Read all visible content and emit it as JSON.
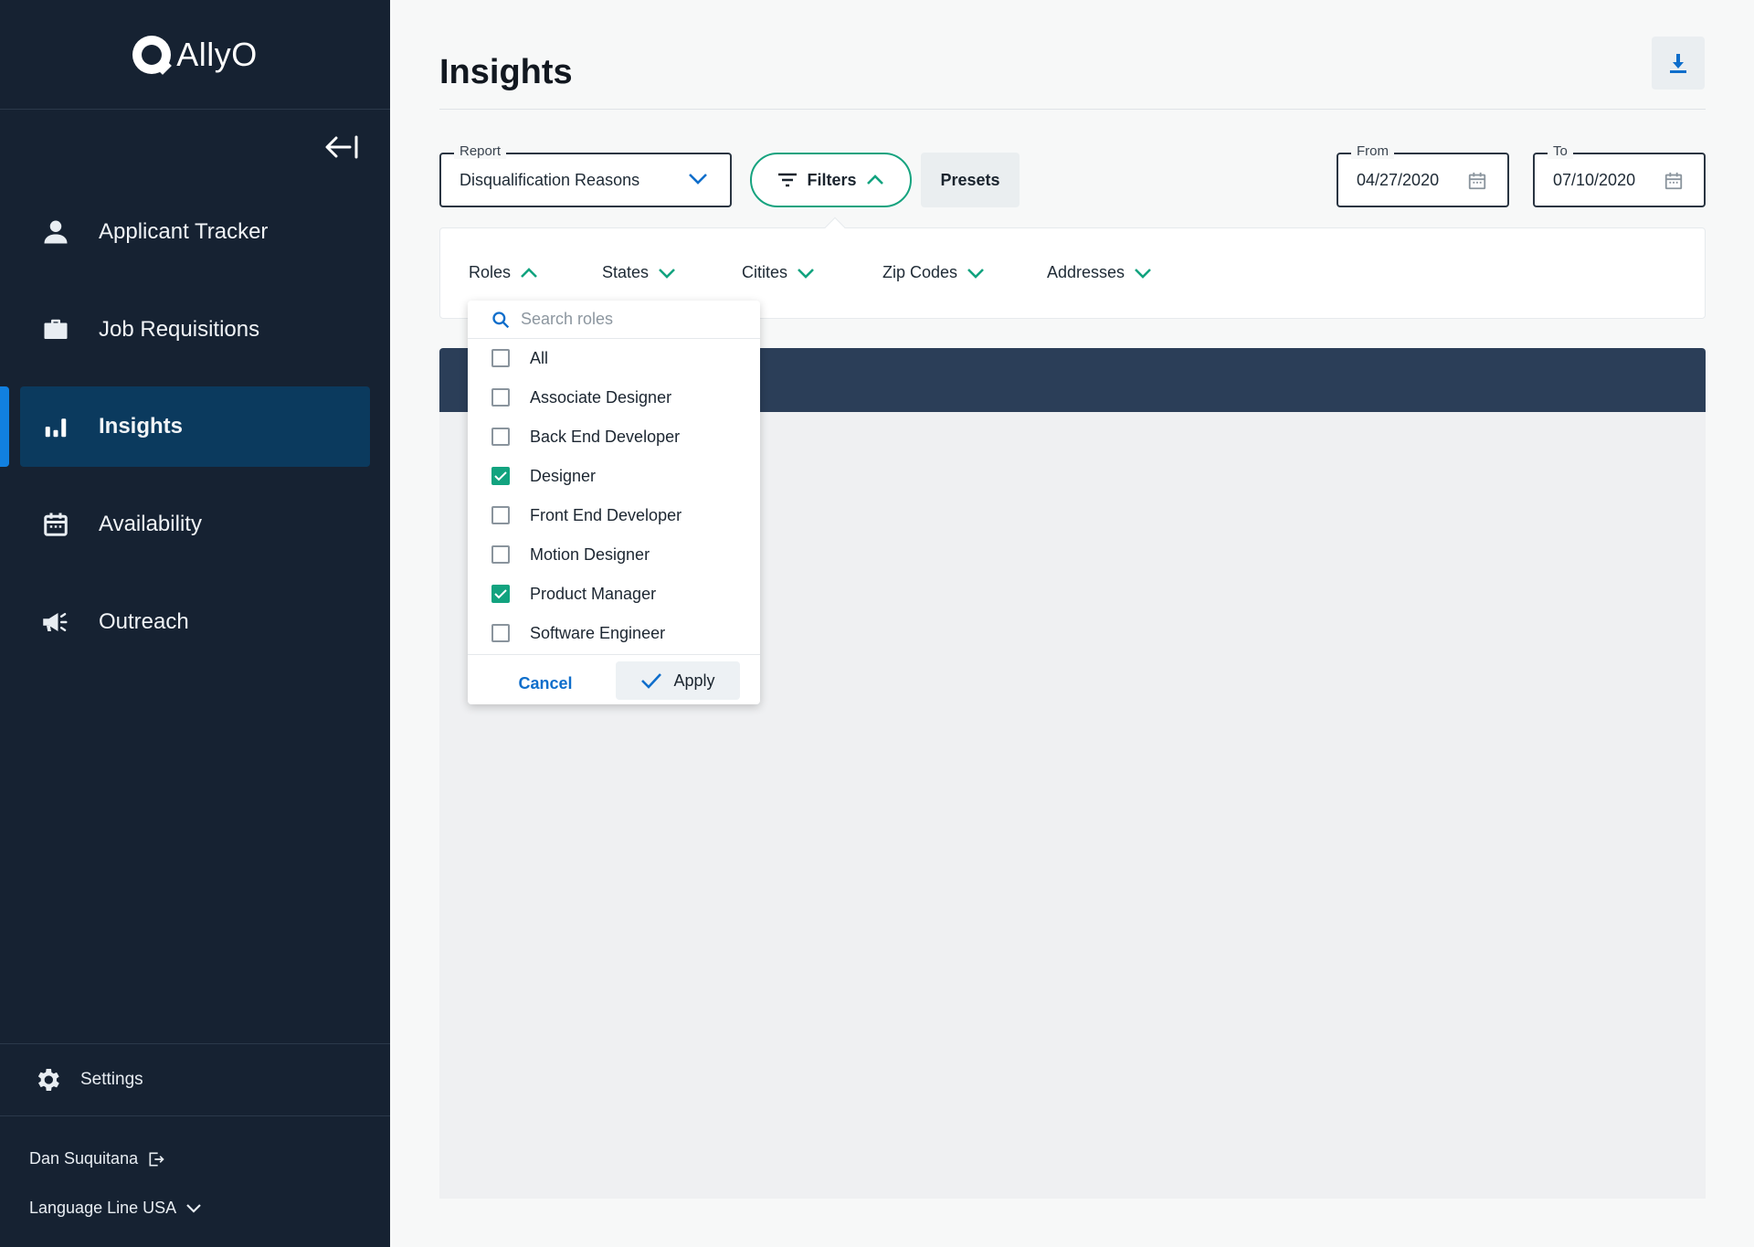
{
  "sidebar": {
    "brand": "AllyO",
    "nav": [
      {
        "label": "Applicant Tracker",
        "icon": "person-icon"
      },
      {
        "label": "Job Requisitions",
        "icon": "briefcase-icon"
      },
      {
        "label": "Insights",
        "icon": "bar-chart-icon",
        "active": true
      },
      {
        "label": "Availability",
        "icon": "calendar-icon"
      },
      {
        "label": "Outreach",
        "icon": "megaphone-icon"
      }
    ],
    "settings_label": "Settings",
    "user_name": "Dan Suquitana",
    "organization": "Language Line USA"
  },
  "header": {
    "title": "Insights"
  },
  "toolbar": {
    "report_legend": "Report",
    "report_value": "Disqualification Reasons",
    "filters_label": "Filters",
    "presets_label": "Presets",
    "from_legend": "From",
    "from_value": "04/27/2020",
    "to_legend": "To",
    "to_value": "07/10/2020"
  },
  "filter_tabs": [
    {
      "label": "Roles",
      "expanded": true
    },
    {
      "label": "States",
      "expanded": false
    },
    {
      "label": "Citites",
      "expanded": false
    },
    {
      "label": "Zip Codes",
      "expanded": false
    },
    {
      "label": "Addresses",
      "expanded": false
    }
  ],
  "roles_dropdown": {
    "search_placeholder": "Search roles",
    "items": [
      {
        "label": "All",
        "checked": false
      },
      {
        "label": "Associate Designer",
        "checked": false
      },
      {
        "label": "Back End Developer",
        "checked": false
      },
      {
        "label": "Designer",
        "checked": true
      },
      {
        "label": "Front End Developer",
        "checked": false
      },
      {
        "label": "Motion Designer",
        "checked": false
      },
      {
        "label": "Product Manager",
        "checked": true
      },
      {
        "label": "Software Engineer",
        "checked": false
      }
    ],
    "cancel_label": "Cancel",
    "apply_label": "Apply"
  },
  "colors": {
    "sidebar_bg": "#162232",
    "active_nav": "#0b3a5e",
    "accent_green": "#12a37f",
    "accent_blue": "#0f6ecb",
    "table_header": "#2b3e58"
  }
}
